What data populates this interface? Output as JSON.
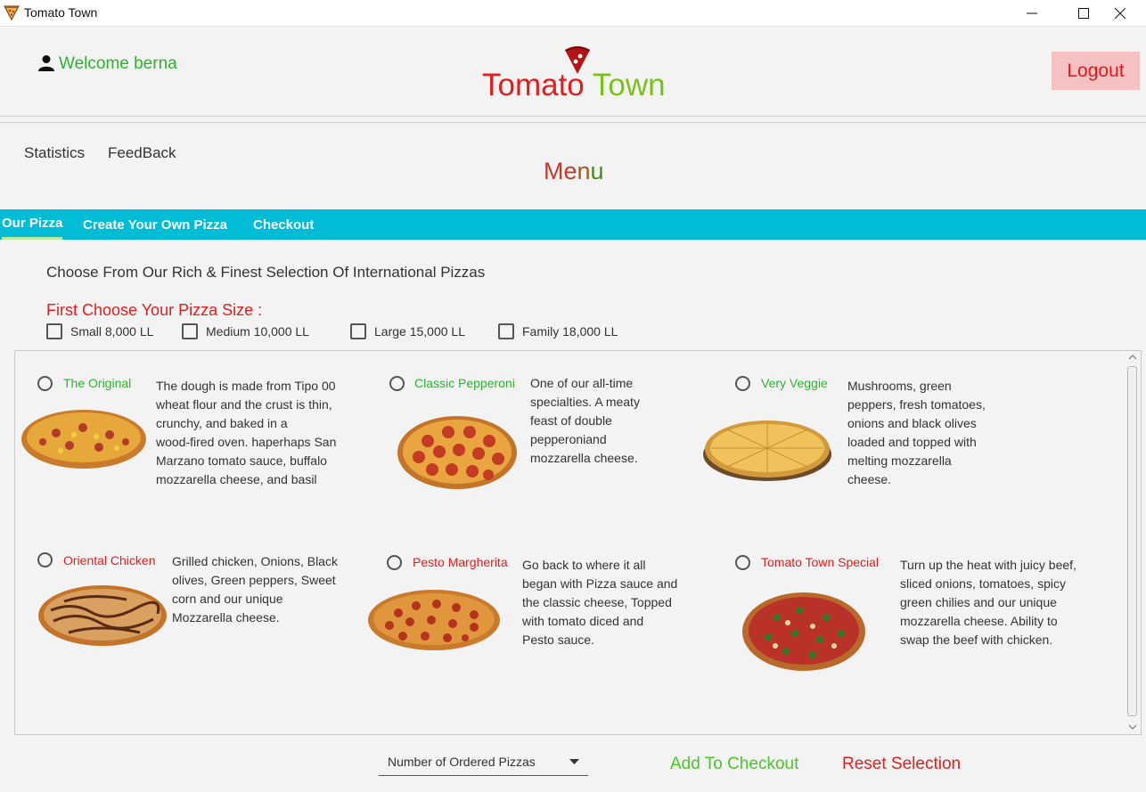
{
  "window": {
    "title": "Tomato Town"
  },
  "header": {
    "welcome": "Welcome berna",
    "logo_part1": "Tomato",
    "logo_part2": "Town",
    "logout_label": "Logout"
  },
  "nav": {
    "statistics": "Statistics",
    "feedback": "FeedBack"
  },
  "menu_title": {
    "part1": "Me",
    "part2": "n",
    "part3": "u"
  },
  "tabs": [
    {
      "label": "Our Pizza",
      "active": true
    },
    {
      "label": "Create Your Own Pizza",
      "active": false
    },
    {
      "label": "Checkout",
      "active": false
    }
  ],
  "intro": "Choose From Our Rich & Finest Selection Of International Pizzas",
  "size_title": "First Choose Your Pizza Size :",
  "sizes": [
    {
      "label": "Small 8,000 LL",
      "checked": false
    },
    {
      "label": "Medium 10,000 LL",
      "checked": false
    },
    {
      "label": "Large 15,000 LL",
      "checked": false
    },
    {
      "label": "Family 18,000 LL",
      "checked": false
    }
  ],
  "pizzas": [
    {
      "name": "The Original",
      "desc": [
        "The dough is made from Tipo 00",
        "wheat flour and the crust is thin,",
        "crunchy, and baked in a",
        "wood-fired oven.  haperhaps San",
        "Marzano tomato sauce, buffalo",
        "mozzarella cheese, and basil"
      ]
    },
    {
      "name": "Classic Pepperoni",
      "desc": [
        "One of our all-time",
        "specialties. A meaty",
        "feast of double",
        "pepperoniand",
        "mozzarella cheese."
      ]
    },
    {
      "name": "Very Veggie",
      "desc": [
        "Mushrooms, green",
        "peppers, fresh tomatoes,",
        "onions and black olives",
        "loaded and topped with",
        "melting mozzarella",
        "cheese."
      ]
    },
    {
      "name": "Oriental Chicken",
      "desc": [
        "Grilled chicken, Onions, Black",
        "olives, Green peppers, Sweet",
        "corn and our unique",
        "Mozzarella cheese."
      ]
    },
    {
      "name": "Pesto Margherita",
      "desc": [
        "Go back to where it all",
        "began with Pizza sauce and",
        "the classic cheese, Topped",
        "with tomato diced and",
        "Pesto sauce."
      ]
    },
    {
      "name": "Tomato Town Special",
      "desc": [
        "Turn up the heat with juicy beef,",
        "sliced onions, tomatoes, spicy",
        "green chilies and our unique",
        "mozzarella cheese. Ability to",
        "swap the beef with chicken."
      ]
    }
  ],
  "bottom": {
    "dropdown_label": "Number of Ordered Pizzas",
    "add_label": "Add To Checkout",
    "reset_label": "Reset Selection"
  },
  "colors": {
    "accent_tab": "#00bcd4",
    "green": "#2fb12f",
    "red": "#e11d1d",
    "logout_bg": "#f6c1c1"
  }
}
